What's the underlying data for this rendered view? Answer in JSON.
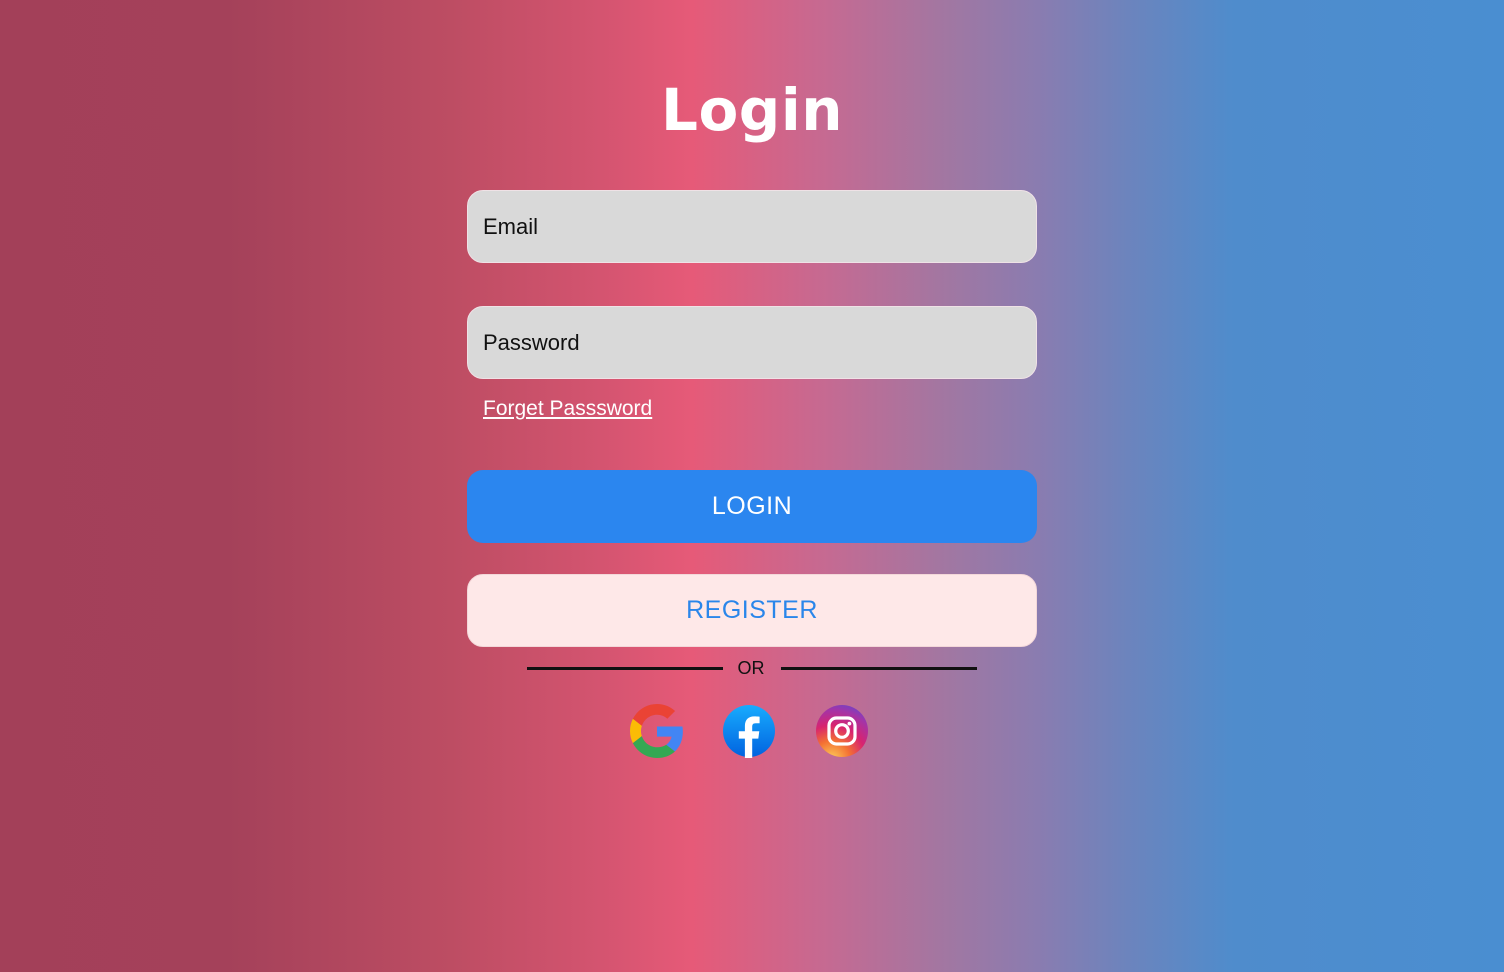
{
  "page": {
    "title": "Login"
  },
  "form": {
    "email_placeholder": "Email",
    "email_value": "",
    "password_placeholder": "Password",
    "password_value": "",
    "forgot_password_label": "Forget Passsword",
    "login_label": "LOGIN",
    "register_label": "REGISTER",
    "divider_label": "OR"
  },
  "social": [
    {
      "name": "google",
      "icon": "google-icon"
    },
    {
      "name": "facebook",
      "icon": "facebook-icon"
    },
    {
      "name": "instagram",
      "icon": "instagram-icon"
    }
  ],
  "colors": {
    "login_button": "#2b86ef",
    "register_button": "#fee8e8",
    "register_text": "#2a86ea",
    "input_background": "#d9d9d9"
  }
}
